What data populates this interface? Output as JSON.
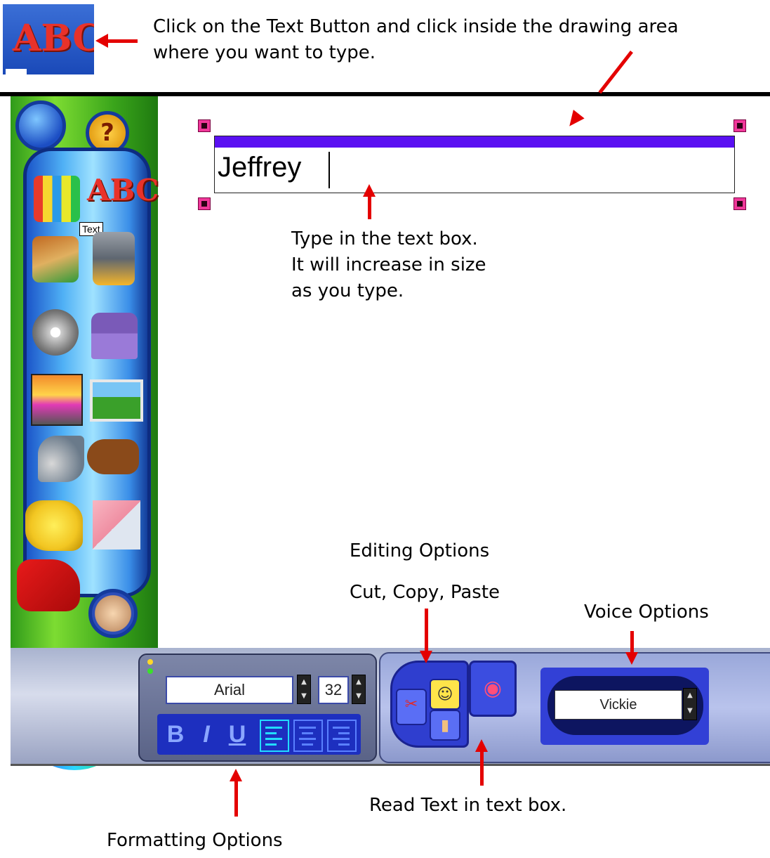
{
  "annotations": {
    "top": "Click on the Text Button and click inside the drawing area\nwhere you want to type.",
    "type_in": "Type in the text box.\nIt will increase in size\nas you type.",
    "editing_title": "Editing Options",
    "editing_sub": "Cut, Copy, Paste",
    "voice": "Voice Options",
    "read": "Read Text in text box.",
    "formatting": "Formatting Options"
  },
  "toolbar": {
    "tooltip": "Text",
    "thumb_letters": "ABC"
  },
  "canvas": {
    "text_value": "Jeffrey"
  },
  "format": {
    "font": "Arial",
    "size": "32",
    "bold": "B",
    "italic": "I",
    "underline": "U"
  },
  "voice_panel": {
    "voice": "Vickie"
  },
  "colors": {
    "arrow": "#e40000",
    "text_box_bar": "#5a10f2",
    "paint_color": "#22d41a"
  },
  "icons": [
    "brain-icon",
    "help-icon",
    "crayons-icon",
    "abc-text-icon",
    "paintbrush-icon",
    "paint-bucket-icon",
    "stickers-icon",
    "stamp-icon",
    "mixing-pot-icon",
    "scene-icon",
    "speaker-music-icon",
    "dog-icon",
    "glove-select-icon",
    "eraser-icon",
    "firecracker-icon",
    "face-icon",
    "scissors-icon",
    "smiley-copy-icon",
    "glue-paste-icon",
    "mouth-read-icon"
  ]
}
